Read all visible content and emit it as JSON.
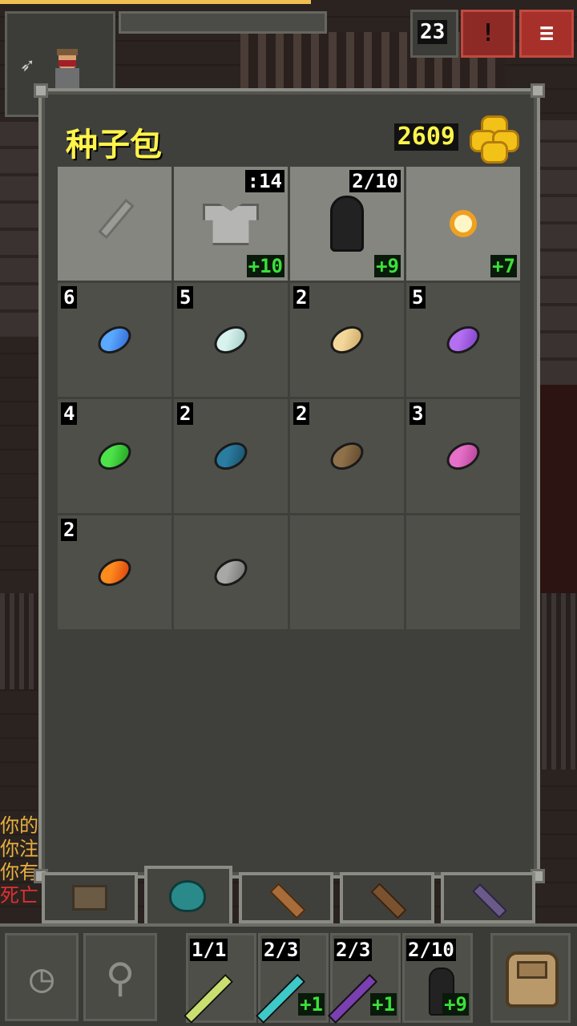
{
  "hud": {
    "depth": "23",
    "journal_glyph": "!",
    "menu_glyph": "≡"
  },
  "log": [
    {
      "text": "你的",
      "color": "#e8b040"
    },
    {
      "text": "你注",
      "color": "#e8b040"
    },
    {
      "text": "你有",
      "color": "#e8b040"
    },
    {
      "text": "死亡",
      "color": "#e03030"
    }
  ],
  "bag": {
    "title": "种子包",
    "gold": "2609",
    "equipment": [
      {
        "name": "weapon-slot-empty",
        "top_right": "",
        "level": ""
      },
      {
        "name": "armor",
        "top_right": ":14",
        "level": "+10"
      },
      {
        "name": "cloak-artifact",
        "top_right": "2/10",
        "level": "+9"
      },
      {
        "name": "ring",
        "top_right": "",
        "level": "+7"
      }
    ],
    "seeds": [
      {
        "qty": "6",
        "color": "#5aa8ff",
        "shade": "#2e63d0"
      },
      {
        "qty": "5",
        "color": "#d8f2ee",
        "shade": "#9cc7c0"
      },
      {
        "qty": "2",
        "color": "#f4d79a",
        "shade": "#c7a360"
      },
      {
        "qty": "5",
        "color": "#b46ef0",
        "shade": "#7a3ec2"
      },
      {
        "qty": "4",
        "color": "#4de24a",
        "shade": "#1f9a1c"
      },
      {
        "qty": "2",
        "color": "#2a7ca0",
        "shade": "#184e66"
      },
      {
        "qty": "2",
        "color": "#8e704a",
        "shade": "#5b4528"
      },
      {
        "qty": "3",
        "color": "#e670c8",
        "shade": "#b13e92"
      },
      {
        "qty": "2",
        "color": "#ff8a1e",
        "shade": "#d43a0c"
      },
      {
        "qty": "",
        "color": "#a8a8a6",
        "shade": "#6e6e6c"
      }
    ],
    "empty_slots": 2
  },
  "quickslots": [
    {
      "count": "1/1",
      "level": "",
      "wand_color": "#c9e070"
    },
    {
      "count": "2/3",
      "level": "+1",
      "wand_color": "#3fc8c8"
    },
    {
      "count": "2/3",
      "level": "+1",
      "wand_color": "#7a3fb0"
    },
    {
      "count": "2/10",
      "level": "+9",
      "wand_color": "#222222"
    }
  ],
  "toolbar": {
    "wait_glyph": "◷",
    "search_glyph": "⚲"
  }
}
